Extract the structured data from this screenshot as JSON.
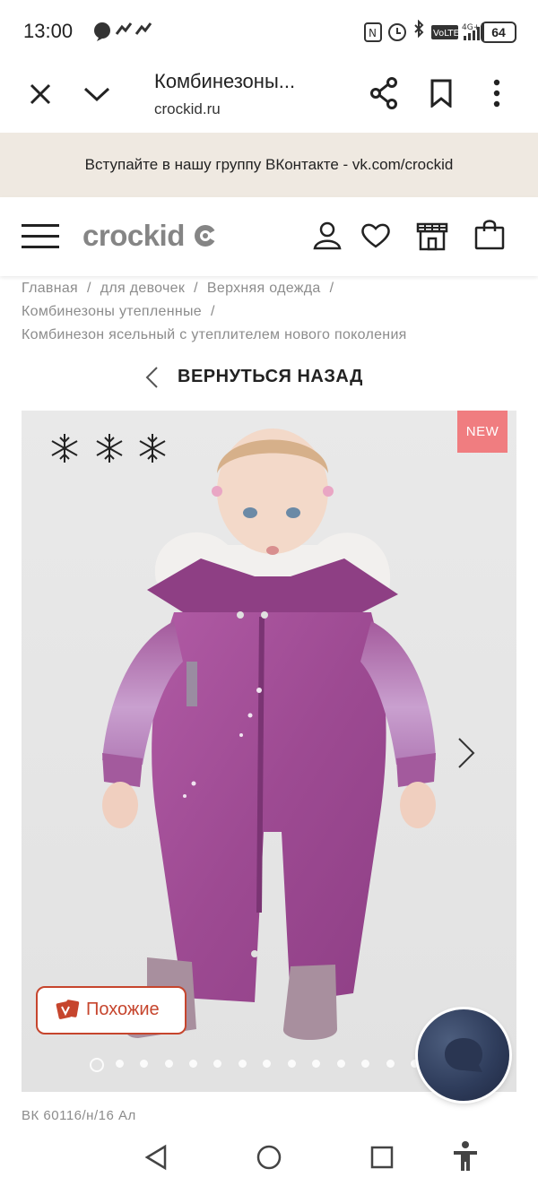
{
  "status_bar": {
    "time": "13:00",
    "battery": "64",
    "network": "4G+"
  },
  "browser": {
    "page_title": "Комбинезоны...",
    "domain": "crockid.ru"
  },
  "promo": {
    "text": "Вступайте в нашу группу ВКонтакте - vk.com/crockid"
  },
  "site_header": {
    "logo_text": "crockid"
  },
  "breadcrumbs": [
    "Главная",
    "для девочек",
    "Верхняя одежда",
    "Комбинезоны утепленные",
    "Комбинезон ясельный с утеплителем нового поколения"
  ],
  "back_label": "ВЕРНУТЬСЯ НАЗАД",
  "product": {
    "badge": "NEW",
    "warmth_level": 3,
    "similar_label": "Похожие",
    "sku": "ВК 60116/н/16 Ал",
    "gallery_dots": 14,
    "active_dot": 1
  },
  "colors": {
    "accent_red": "#c6452d",
    "badge_pink": "#f07d80",
    "banner_beige": "#efe9e1",
    "suit_purple": "#a24d96"
  }
}
